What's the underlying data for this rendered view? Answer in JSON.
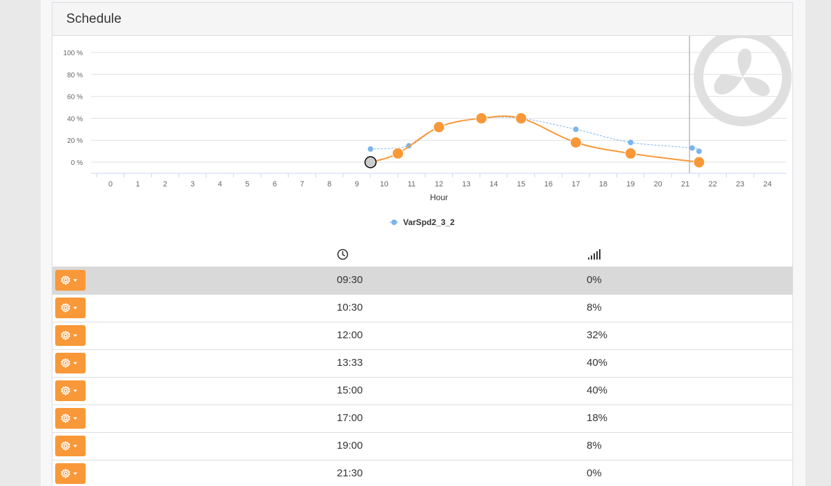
{
  "panel": {
    "title": "Schedule"
  },
  "chart_data": {
    "type": "line",
    "xlabel": "Hour",
    "xlim": [
      0,
      24
    ],
    "ylim": [
      0,
      100
    ],
    "x_ticks": [
      "0",
      "1",
      "2",
      "3",
      "4",
      "5",
      "6",
      "7",
      "8",
      "9",
      "10",
      "11",
      "12",
      "13",
      "14",
      "15",
      "16",
      "17",
      "18",
      "19",
      "20",
      "21",
      "22",
      "23",
      "24"
    ],
    "y_ticks": [
      "0 %",
      "20 %",
      "40 %",
      "60 %",
      "80 %",
      "100 %"
    ],
    "current_time_marker": 21.15,
    "series": [
      {
        "name": "VarSpd2_3_2",
        "color": "#7cb5ec",
        "x": [
          9.5,
          10.9,
          12,
          13.55,
          15,
          17,
          19,
          21.25,
          21.5
        ],
        "y": [
          12,
          15,
          32,
          40,
          40,
          30,
          18,
          13,
          10
        ]
      },
      {
        "color": "#f99838",
        "x": [
          9.5,
          10.5,
          12,
          13.55,
          15,
          17,
          19,
          21.5
        ],
        "y": [
          0,
          8,
          32,
          40,
          40,
          18,
          8,
          0
        ]
      }
    ],
    "legend": [
      "VarSpd2_3_2"
    ]
  },
  "table": {
    "icons": {
      "time": "clock-icon",
      "value": "signal-bars-icon"
    },
    "rows": [
      {
        "time": "09:30",
        "value": "0%",
        "selected": true
      },
      {
        "time": "10:30",
        "value": "8%"
      },
      {
        "time": "12:00",
        "value": "32%"
      },
      {
        "time": "13:33",
        "value": "40%"
      },
      {
        "time": "15:00",
        "value": "40%"
      },
      {
        "time": "17:00",
        "value": "18%"
      },
      {
        "time": "19:00",
        "value": "8%"
      },
      {
        "time": "21:30",
        "value": "0%"
      }
    ]
  },
  "colors": {
    "accent": "#f99838",
    "series_blue": "#7cb5ec"
  }
}
